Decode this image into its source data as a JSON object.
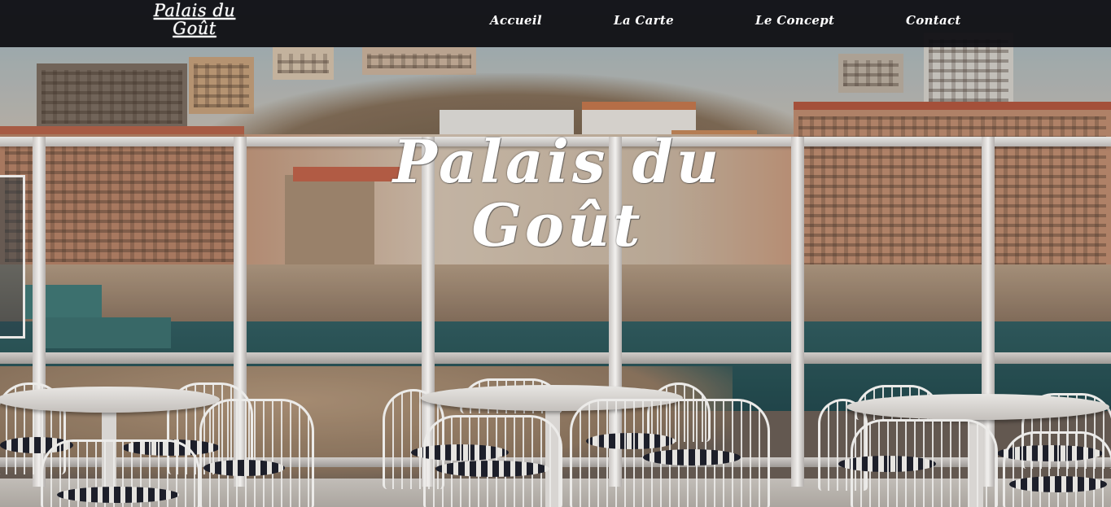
{
  "brand": {
    "line1": "Palais du",
    "line2": "Goût"
  },
  "nav": {
    "items": [
      {
        "label": "Accueil"
      },
      {
        "label": "La Carte"
      },
      {
        "label": "Le Concept"
      },
      {
        "label": "Contact"
      }
    ]
  },
  "hero": {
    "line1": "Palais du",
    "line2": "Goût"
  },
  "colors": {
    "navbar": "#0e0e12",
    "text": "#ffffff"
  }
}
